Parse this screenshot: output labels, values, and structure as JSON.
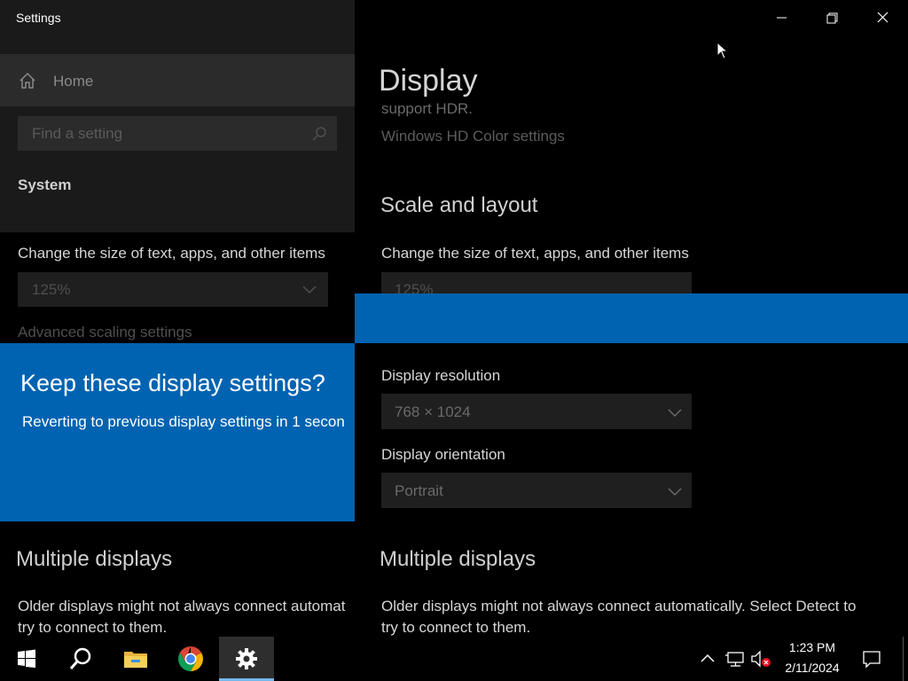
{
  "window": {
    "app_title": "Settings",
    "page_title": "Display",
    "controls": {
      "minimize": "minimize-icon",
      "restore": "restore-icon",
      "close": "close-icon"
    }
  },
  "sidebar": {
    "home_label": "Home",
    "search_placeholder": "Find a setting",
    "section_label": "System"
  },
  "left_content": {
    "change_size_label": "Change the size of text, apps, and other items",
    "scale_value": "125%",
    "advanced_scaling_link": "Advanced scaling settings",
    "multiple_displays_heading": "Multiple displays",
    "older_displays_line1": "Older displays might not always connect automat",
    "older_displays_line2": "try to connect to them."
  },
  "dialog": {
    "title": "Keep these display settings?",
    "message": "Reverting to previous display settings in  1 secon"
  },
  "main": {
    "support_hdr_text": "support HDR.",
    "hd_color_link": "Windows HD Color settings",
    "scale_layout_heading": "Scale and layout",
    "change_size_label": "Change the size of text, apps, and other items",
    "scale_value": "125%",
    "resolution_label": "Display resolution",
    "resolution_value": "768 × 1024",
    "orientation_label": "Display orientation",
    "orientation_value": "Portrait",
    "multiple_displays_heading": "Multiple displays",
    "older_displays_line1": "Older displays might not always connect automatically. Select Detect to",
    "older_displays_line2": "try to connect to them."
  },
  "taskbar": {
    "pinned": [
      "windows-start-icon",
      "search-icon",
      "file-explorer-icon",
      "chrome-icon",
      "settings-gear-icon"
    ],
    "active_app": "Settings",
    "clock_time": "1:23 PM",
    "clock_date": "2/11/2024"
  },
  "colors": {
    "accent_blue": "#0063b1",
    "background": "#000000",
    "sidebar_bg": "#1a1a1a",
    "control_bg": "#1f1f1f",
    "taskbar_active_underline": "#76b9ed"
  }
}
